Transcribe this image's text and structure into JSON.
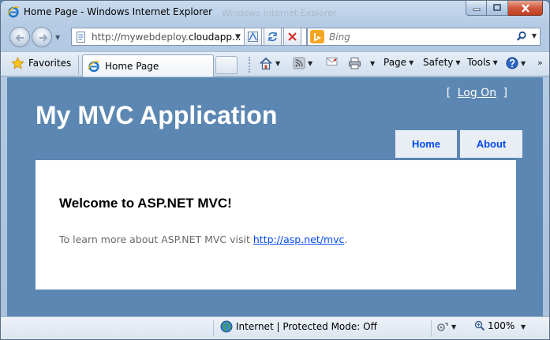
{
  "window": {
    "title": "Home Page - Windows Internet Explorer",
    "ghost_title": "Windows Internet Explorer"
  },
  "address_bar": {
    "url_prefix": "http://mywebdeploy.",
    "url_domain": "cloudapp..."
  },
  "search": {
    "placeholder": "Bing"
  },
  "command_bar": {
    "favorites_label": "Favorites",
    "tab_label": "Home Page",
    "page_label": "Page",
    "safety_label": "Safety",
    "tools_label": "Tools"
  },
  "site": {
    "logon_open": "[",
    "logon_link": "Log On",
    "logon_close": "]",
    "title": "My MVC Application",
    "menu": [
      {
        "label": "Home"
      },
      {
        "label": "About"
      }
    ],
    "heading": "Welcome to ASP.NET MVC!",
    "body_text": "To learn more about ASP.NET MVC visit ",
    "body_link": "http://asp.net/mvc",
    "body_end": "."
  },
  "status_bar": {
    "zone_text": "Internet | Protected Mode: Off",
    "zoom": "100%"
  },
  "colors": {
    "page_background": "#5c87b2",
    "menu_link": "#034af3",
    "body_text": "#696969"
  }
}
